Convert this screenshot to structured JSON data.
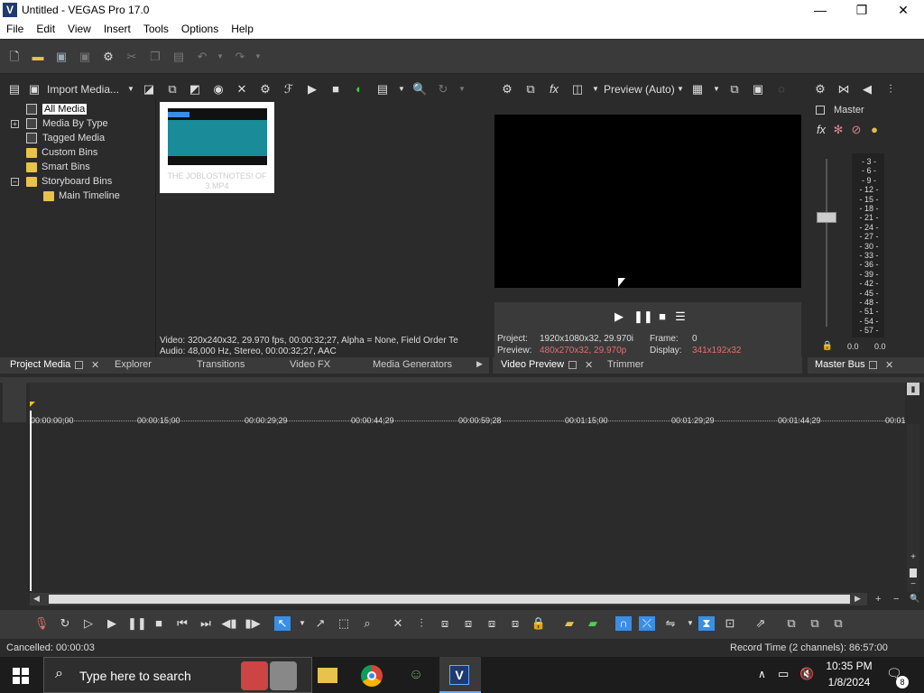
{
  "window": {
    "title": "Untitled - VEGAS Pro 17.0",
    "app_icon": "V"
  },
  "menu": [
    "File",
    "Edit",
    "View",
    "Insert",
    "Tools",
    "Options",
    "Help"
  ],
  "project_media": {
    "import_label": "Import Media...",
    "tree": [
      "All Media",
      "Media By Type",
      "Tagged Media",
      "Custom Bins",
      "Smart Bins",
      "Storyboard Bins",
      "Main Timeline"
    ],
    "clip_caption": "THE JOBLOSTNOTES! OF 3.MP4",
    "info_video": "Video: 320x240x32, 29.970 fps, 00:00:32;27, Alpha = None, Field Order Te",
    "info_audio": "Audio: 48,000 Hz, Stereo, 00:00:32;27, AAC"
  },
  "left_tabs": [
    "Project Media",
    "Explorer",
    "Transitions",
    "Video FX",
    "Media Generators"
  ],
  "preview": {
    "mode_label": "Preview (Auto)",
    "project_label": "Project:",
    "project_value": "1920x1080x32, 29.970i",
    "frame_label": "Frame:",
    "frame_value": "0",
    "preview_label": "Preview:",
    "preview_value": "480x270x32, 29.970p",
    "display_label": "Display:",
    "display_value": "341x192x32",
    "tabs": [
      "Video Preview",
      "Trimmer"
    ]
  },
  "master": {
    "label": "Master",
    "tab": "Master Bus",
    "scale": [
      "3",
      "6",
      "9",
      "12",
      "15",
      "18",
      "21",
      "24",
      "27",
      "30",
      "33",
      "36",
      "39",
      "42",
      "45",
      "48",
      "51",
      "54",
      "57"
    ],
    "left_value": "0.0",
    "right_value": "0.0"
  },
  "timeline": {
    "ruler": [
      "00:00:00;00",
      "00:00:15;00",
      "00:00:29;29",
      "00:00:44;29",
      "00:00:59;28",
      "00:01:15;00",
      "00:01:29;29",
      "00:01:44;29",
      "00:01"
    ]
  },
  "status": {
    "left": "Cancelled: 00:00:03",
    "right": "Record Time (2 channels): 86:57:00"
  },
  "taskbar": {
    "search_placeholder": "Type here to search",
    "time": "10:35 PM",
    "date": "1/8/2024",
    "notifications": "8"
  },
  "colors": {
    "highlight_value": "#e07070",
    "accent_blue": "#3a8ee6"
  }
}
